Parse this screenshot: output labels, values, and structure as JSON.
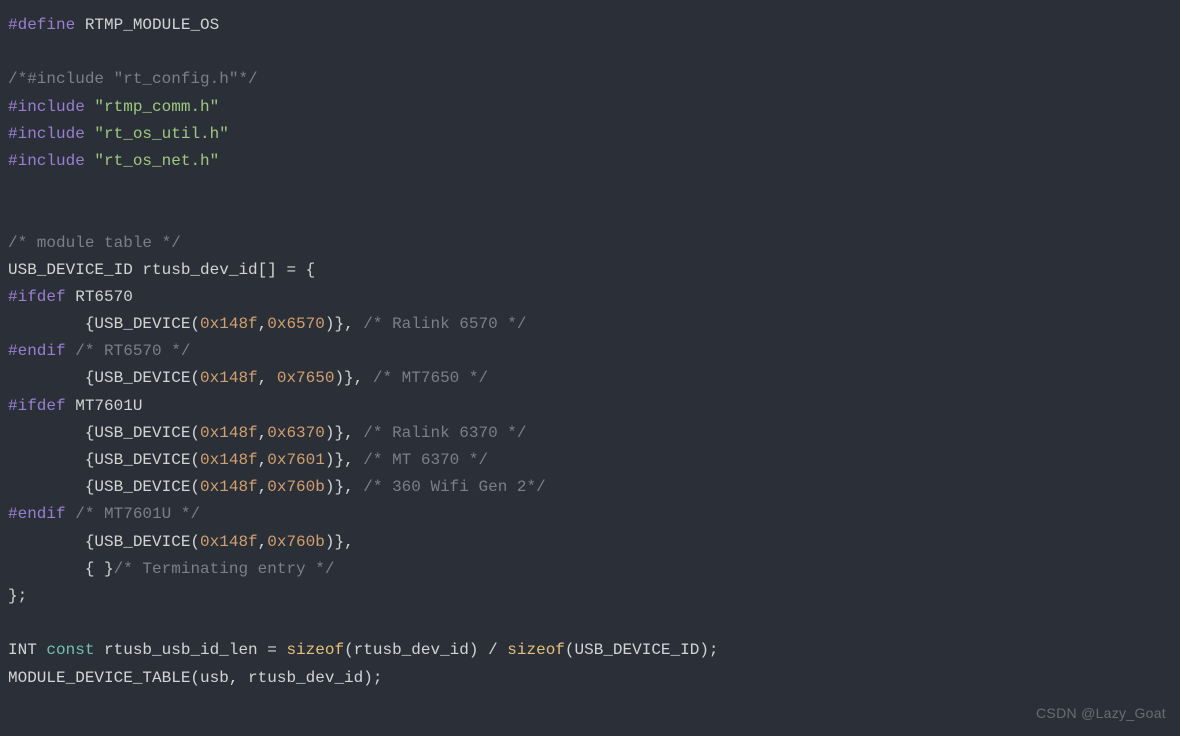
{
  "watermark": "CSDN @Lazy_Goat",
  "lines": [
    [
      {
        "cls": "c-directive",
        "t": "#define"
      },
      {
        "cls": "c-plain",
        "t": " RTMP_MODULE_OS"
      }
    ],
    [
      {
        "cls": "c-plain",
        "t": ""
      }
    ],
    [
      {
        "cls": "c-comment",
        "t": "/*#include \"rt_config.h\"*/"
      }
    ],
    [
      {
        "cls": "c-directive",
        "t": "#include"
      },
      {
        "cls": "c-plain",
        "t": " "
      },
      {
        "cls": "c-string",
        "t": "\"rtmp_comm.h\""
      }
    ],
    [
      {
        "cls": "c-directive",
        "t": "#include"
      },
      {
        "cls": "c-plain",
        "t": " "
      },
      {
        "cls": "c-string",
        "t": "\"rt_os_util.h\""
      }
    ],
    [
      {
        "cls": "c-directive",
        "t": "#include"
      },
      {
        "cls": "c-plain",
        "t": " "
      },
      {
        "cls": "c-string",
        "t": "\"rt_os_net.h\""
      }
    ],
    [
      {
        "cls": "c-plain",
        "t": ""
      }
    ],
    [
      {
        "cls": "c-plain",
        "t": ""
      }
    ],
    [
      {
        "cls": "c-comment",
        "t": "/* module table */"
      }
    ],
    [
      {
        "cls": "c-plain",
        "t": "USB_DEVICE_ID rtusb_dev_id[] = {"
      }
    ],
    [
      {
        "cls": "c-directive",
        "t": "#ifdef"
      },
      {
        "cls": "c-plain",
        "t": " RT6570"
      }
    ],
    [
      {
        "cls": "c-plain",
        "t": "        {USB_DEVICE("
      },
      {
        "cls": "c-hex",
        "t": "0x148f"
      },
      {
        "cls": "c-plain",
        "t": ","
      },
      {
        "cls": "c-hex",
        "t": "0x6570"
      },
      {
        "cls": "c-plain",
        "t": ")}, "
      },
      {
        "cls": "c-comment",
        "t": "/* Ralink 6570 */"
      }
    ],
    [
      {
        "cls": "c-directive",
        "t": "#endif"
      },
      {
        "cls": "c-plain",
        "t": " "
      },
      {
        "cls": "c-comment",
        "t": "/* RT6570 */"
      }
    ],
    [
      {
        "cls": "c-plain",
        "t": "        {USB_DEVICE("
      },
      {
        "cls": "c-hex",
        "t": "0x148f"
      },
      {
        "cls": "c-plain",
        "t": ", "
      },
      {
        "cls": "c-hex",
        "t": "0x7650"
      },
      {
        "cls": "c-plain",
        "t": ")}, "
      },
      {
        "cls": "c-comment",
        "t": "/* MT7650 */"
      }
    ],
    [
      {
        "cls": "c-directive",
        "t": "#ifdef"
      },
      {
        "cls": "c-plain",
        "t": " MT7601U"
      }
    ],
    [
      {
        "cls": "c-plain",
        "t": "        {USB_DEVICE("
      },
      {
        "cls": "c-hex",
        "t": "0x148f"
      },
      {
        "cls": "c-plain",
        "t": ","
      },
      {
        "cls": "c-hex",
        "t": "0x6370"
      },
      {
        "cls": "c-plain",
        "t": ")}, "
      },
      {
        "cls": "c-comment",
        "t": "/* Ralink 6370 */"
      }
    ],
    [
      {
        "cls": "c-plain",
        "t": "        {USB_DEVICE("
      },
      {
        "cls": "c-hex",
        "t": "0x148f"
      },
      {
        "cls": "c-plain",
        "t": ","
      },
      {
        "cls": "c-hex",
        "t": "0x7601"
      },
      {
        "cls": "c-plain",
        "t": ")}, "
      },
      {
        "cls": "c-comment",
        "t": "/* MT 6370 */"
      }
    ],
    [
      {
        "cls": "c-plain",
        "t": "        {USB_DEVICE("
      },
      {
        "cls": "c-hex",
        "t": "0x148f"
      },
      {
        "cls": "c-plain",
        "t": ","
      },
      {
        "cls": "c-hex",
        "t": "0x760b"
      },
      {
        "cls": "c-plain",
        "t": ")}, "
      },
      {
        "cls": "c-comment",
        "t": "/* 360 Wifi Gen 2*/"
      }
    ],
    [
      {
        "cls": "c-directive",
        "t": "#endif"
      },
      {
        "cls": "c-plain",
        "t": " "
      },
      {
        "cls": "c-comment",
        "t": "/* MT7601U */"
      }
    ],
    [
      {
        "cls": "c-plain",
        "t": "        {USB_DEVICE("
      },
      {
        "cls": "c-hex",
        "t": "0x148f"
      },
      {
        "cls": "c-plain",
        "t": ","
      },
      {
        "cls": "c-hex",
        "t": "0x760b"
      },
      {
        "cls": "c-plain",
        "t": ")},"
      }
    ],
    [
      {
        "cls": "c-plain",
        "t": "        { }"
      },
      {
        "cls": "c-comment",
        "t": "/* Terminating entry */"
      }
    ],
    [
      {
        "cls": "c-plain",
        "t": "};"
      }
    ],
    [
      {
        "cls": "c-plain",
        "t": ""
      }
    ],
    [
      {
        "cls": "c-plain",
        "t": "INT "
      },
      {
        "cls": "c-keyword",
        "t": "const"
      },
      {
        "cls": "c-plain",
        "t": " rtusb_usb_id_len = "
      },
      {
        "cls": "c-sizeof",
        "t": "sizeof"
      },
      {
        "cls": "c-plain",
        "t": "(rtusb_dev_id) / "
      },
      {
        "cls": "c-sizeof",
        "t": "sizeof"
      },
      {
        "cls": "c-plain",
        "t": "(USB_DEVICE_ID);"
      }
    ],
    [
      {
        "cls": "c-plain",
        "t": "MODULE_DEVICE_TABLE(usb, rtusb_dev_id);"
      }
    ]
  ]
}
